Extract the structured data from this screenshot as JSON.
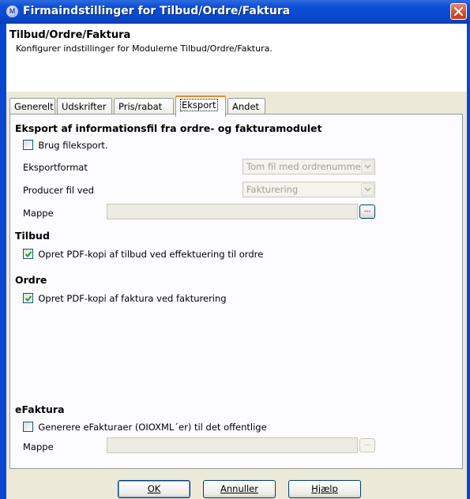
{
  "window": {
    "title": "Firmaindstillinger for Tilbud/Ordre/Faktura"
  },
  "header": {
    "title": "Tilbud/Ordre/Faktura",
    "description": "Konfigurer indstillinger for Modulerne Tilbud/Ordre/Faktura."
  },
  "tabs": [
    {
      "label": "Generelt"
    },
    {
      "label": "Udskrifter"
    },
    {
      "label": "Pris/rabat"
    },
    {
      "label": "Eksport"
    },
    {
      "label": "Andet"
    }
  ],
  "active_tab": "Eksport",
  "export": {
    "section_title": "Eksport af informationsfil fra ordre- og fakturamodulet",
    "use_export_label": "Brug fileksport.",
    "use_export_checked": false,
    "format_label": "Eksportformat",
    "format_value": "Tom fil med ordrenumme",
    "produce_label": "Producer fil ved",
    "produce_value": "Fakturering",
    "folder_label": "Mappe",
    "folder_value": "",
    "browse_label": "..."
  },
  "tilbud": {
    "section_title": "Tilbud",
    "pdf_label": "Opret PDF-kopi af tilbud ved effektuering til ordre",
    "pdf_checked": true
  },
  "ordre": {
    "section_title": "Ordre",
    "pdf_label": "Opret PDF-kopi af faktura ved fakturering",
    "pdf_checked": true
  },
  "efaktura": {
    "section_title": "eFaktura",
    "generate_label": "Generere eFakturaer (OIOXML´er) til det offentlige",
    "generate_checked": false,
    "folder_label": "Mappe",
    "folder_value": "",
    "browse_label": "..."
  },
  "buttons": {
    "ok": "OK",
    "cancel": "Annuller",
    "help": "Hjælp"
  },
  "colors": {
    "titlebar": "#0a48d0",
    "dialog_bg": "#ece9d8",
    "active_tab_accent": "#e68b2c",
    "close_button": "#d24d2a"
  }
}
